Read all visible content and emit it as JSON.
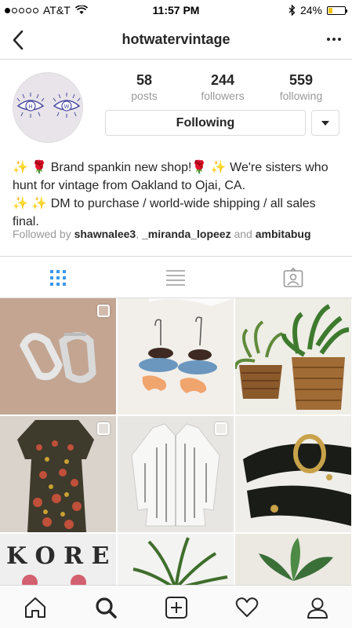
{
  "status_bar": {
    "carrier": "AT&T",
    "time": "11:57 PM",
    "battery": "24%",
    "battery_level": 0.24
  },
  "nav": {
    "title": "hotwatervintage"
  },
  "profile": {
    "stats": [
      {
        "value": "58",
        "label": "posts"
      },
      {
        "value": "244",
        "label": "followers"
      },
      {
        "value": "559",
        "label": "following"
      }
    ],
    "following_button": "Following",
    "bio_line1": "✨ 🌹 Brand spankin new shop!🌹 ✨  We're sisters who hunt for vintage from Oakland to Ojai, CA.",
    "bio_line2": "✨ ✨ DM to purchase / world-wide shipping / all sales final.",
    "followed_by": {
      "prefix": "Followed by",
      "users": [
        "shawnalee3",
        "_miranda_lopeez",
        "ambitabug"
      ],
      "sep": ",",
      "conj": "and"
    }
  },
  "tabs": [
    "grid-view",
    "list-view",
    "tagged-view"
  ],
  "colors": {
    "accent": "#3897f0",
    "text": "#262626",
    "muted": "#999999",
    "border": "#dbdbdb"
  },
  "grid_items": [
    {
      "name": "silver-hoop-earrings",
      "multi": true
    },
    {
      "name": "blue-orange-fish-earrings",
      "multi": false
    },
    {
      "name": "potted-plants-baskets",
      "multi": false
    },
    {
      "name": "floral-vintage-dress",
      "multi": true
    },
    {
      "name": "white-print-jacket",
      "multi": true
    },
    {
      "name": "black-gold-belt",
      "multi": false
    },
    {
      "name": "korea-embroidered-patch",
      "multi": false
    },
    {
      "name": "spider-plant",
      "multi": false
    },
    {
      "name": "hanging-plant",
      "multi": false
    }
  ],
  "bottom_nav": [
    "home-icon",
    "search-icon",
    "add-post-icon",
    "activity-heart-icon",
    "profile-icon"
  ]
}
